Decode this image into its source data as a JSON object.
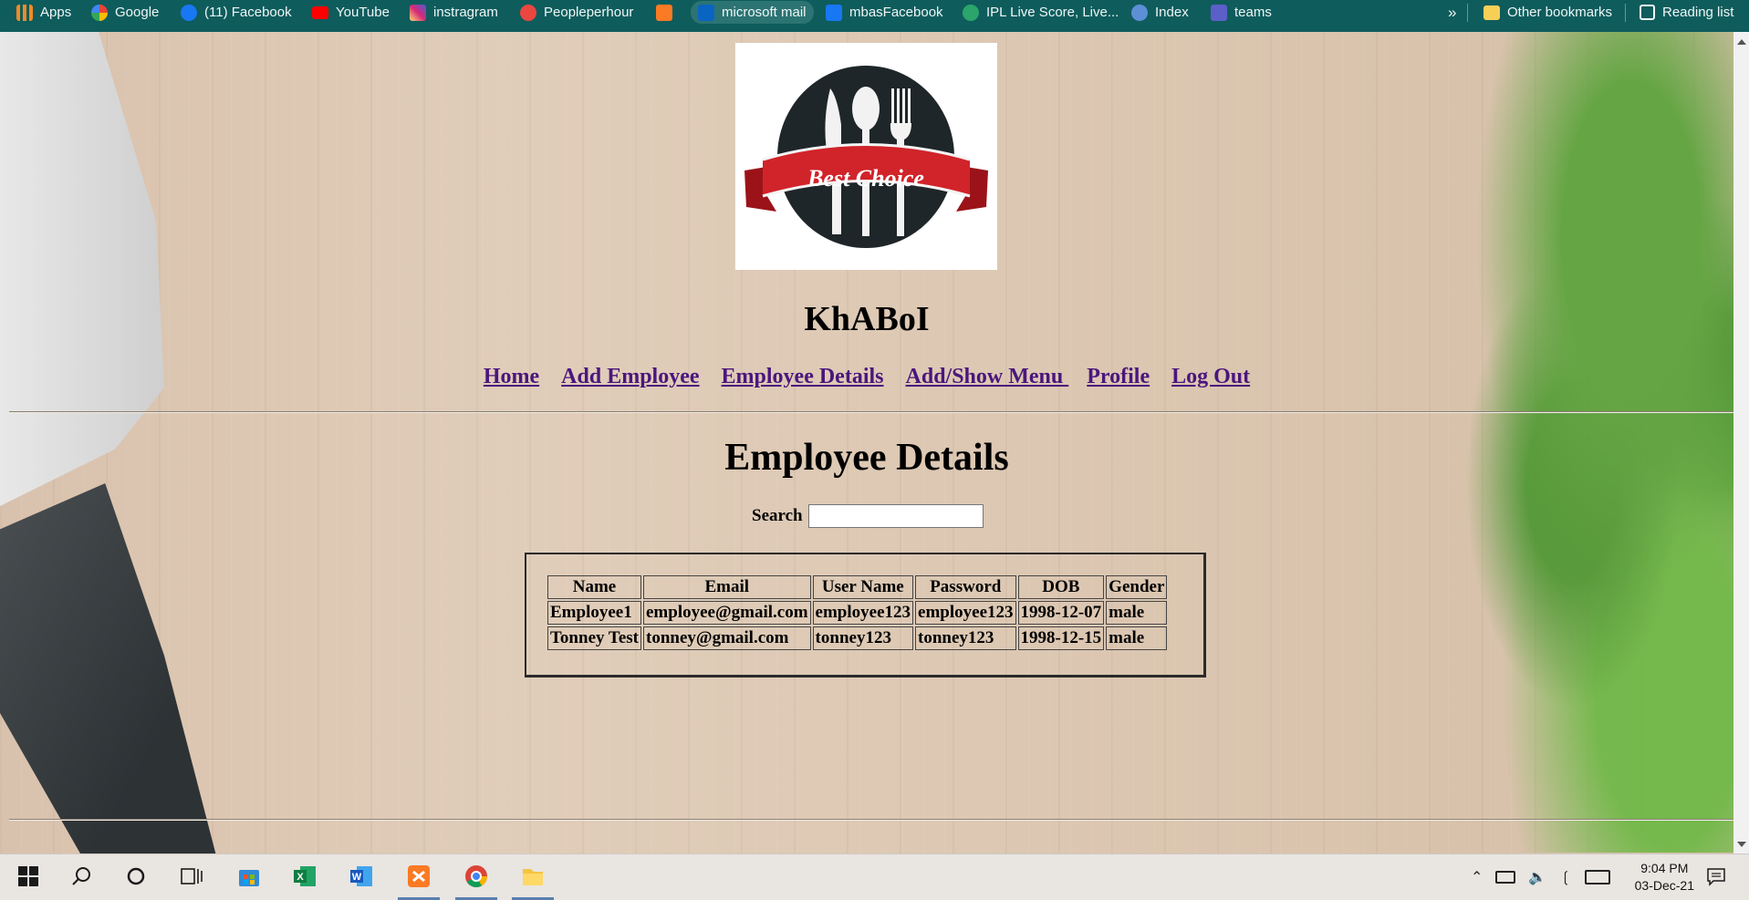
{
  "bookmarks": {
    "items": [
      {
        "label": "Apps",
        "icon": "apps-grid-icon",
        "color": "#f28b24"
      },
      {
        "label": "Google",
        "icon": "google-icon",
        "color": "#ffffff"
      },
      {
        "label": "(11) Facebook",
        "icon": "facebook-icon",
        "color": "#1877f2"
      },
      {
        "label": "YouTube",
        "icon": "youtube-icon",
        "color": "#ff0000"
      },
      {
        "label": "instragram",
        "icon": "instagram-icon",
        "color": "#d62976"
      },
      {
        "label": "Peopleperhour",
        "icon": "peopleperhour-icon",
        "color": "#e9473f"
      },
      {
        "label": "",
        "icon": "xampp-icon",
        "color": "#fb7a24"
      },
      {
        "label": "microsoft mail",
        "icon": "outlook-icon",
        "color": "#0a64c2"
      },
      {
        "label": "mbasFacebook",
        "icon": "facebook-icon",
        "color": "#1877f2"
      },
      {
        "label": "IPL Live Score, Live...",
        "icon": "cricbuzz-icon",
        "color": "#2ba56b"
      },
      {
        "label": "Index",
        "icon": "shield-icon",
        "color": "#5d8fd6"
      },
      {
        "label": "teams",
        "icon": "teams-icon",
        "color": "#5b5fc7"
      }
    ],
    "more": "»",
    "other": "Other bookmarks",
    "reading": "Reading list"
  },
  "site": {
    "logo_text": "Best Choice",
    "title": "KhABoI"
  },
  "nav": [
    "Home",
    "Add Employee",
    "Employee Details",
    "Add/Show Menu ",
    "Profile",
    "Log Out"
  ],
  "main": {
    "heading": "Employee Details",
    "search_label": "Search",
    "search_value": ""
  },
  "table": {
    "headers": [
      "Name",
      "Email",
      "User Name",
      "Password",
      "DOB",
      "Gender"
    ],
    "rows": [
      [
        "Employee1",
        "employee@gmail.com",
        "employee123",
        "employee123",
        "1998-12-07",
        "male"
      ],
      [
        "Tonney Test",
        "tonney@gmail.com",
        "tonney123",
        "tonney123",
        "1998-12-15",
        "male"
      ]
    ]
  },
  "taskbar": {
    "time": "9:04 PM",
    "date": "03-Dec-21"
  }
}
